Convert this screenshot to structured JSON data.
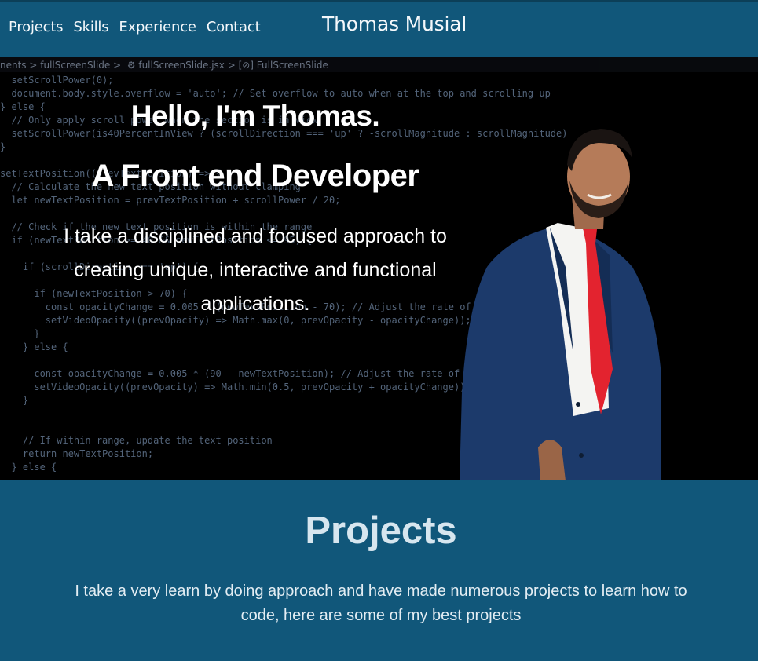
{
  "nav": {
    "links": [
      "Projects",
      "Skills",
      "Experience",
      "Contact"
    ],
    "brand": "Thomas Musial"
  },
  "hero": {
    "breadcrumb": "nents > fullScreenSlide >  ⚙ fullScreenSlide.jsx > [⊘] FullScreenSlide",
    "hello": "Hello, I'm Thomas.",
    "role": "A Front end Developer",
    "description": "I take a disciplined and focused approach to creating unique, interactive and functional applications.",
    "code_lines": [
      "  setScrollPower(0);",
      "  document.body.style.overflow = 'auto'; // Set overflow to auto when at the top and scrolling up",
      "} else {",
      "  // Only apply scroll power when the section is in view",
      "  setScrollPower(is40PercentInView ? (scrollDirection === 'up' ? -scrollMagnitude : scrollMagnitude)",
      "}",
      "",
      "setTextPosition((prevTextPosition) => {",
      "  // Calculate the new text position without clamping",
      "  let newTextPosition = prevTextPosition + scrollPower / 20;",
      "",
      "  // Check if the new text position is within the range",
      "  if (newTextPosition >= 40 && newTextPosition <= 95) {",
      "",
      "    if (scrollDirection === 'up') {",
      "",
      "      if (newTextPosition > 70) {",
      "        const opacityChange = 0.005 * (newTextPosition - 70); // Adjust the rate of change",
      "        setVideoOpacity((prevOpacity) => Math.max(0, prevOpacity - opacityChange));",
      "      }",
      "    } else {",
      "",
      "      const opacityChange = 0.005 * (90 - newTextPosition); // Adjust the rate of opacity change",
      "      setVideoOpacity((prevOpacity) => Math.min(0.5, prevOpacity + opacityChange));",
      "    }",
      "",
      "",
      "    // If within range, update the text position",
      "    return newTextPosition;",
      "  } else {"
    ]
  },
  "projects": {
    "title": "Projects",
    "description": "I take a very learn by doing approach and have made numerous projects to learn how to code, here are some of my best projects"
  },
  "colors": {
    "nav_bg": "#11577a",
    "section_bg": "#11577a",
    "tie": "#e3232f",
    "suit": "#1c3a6b"
  }
}
